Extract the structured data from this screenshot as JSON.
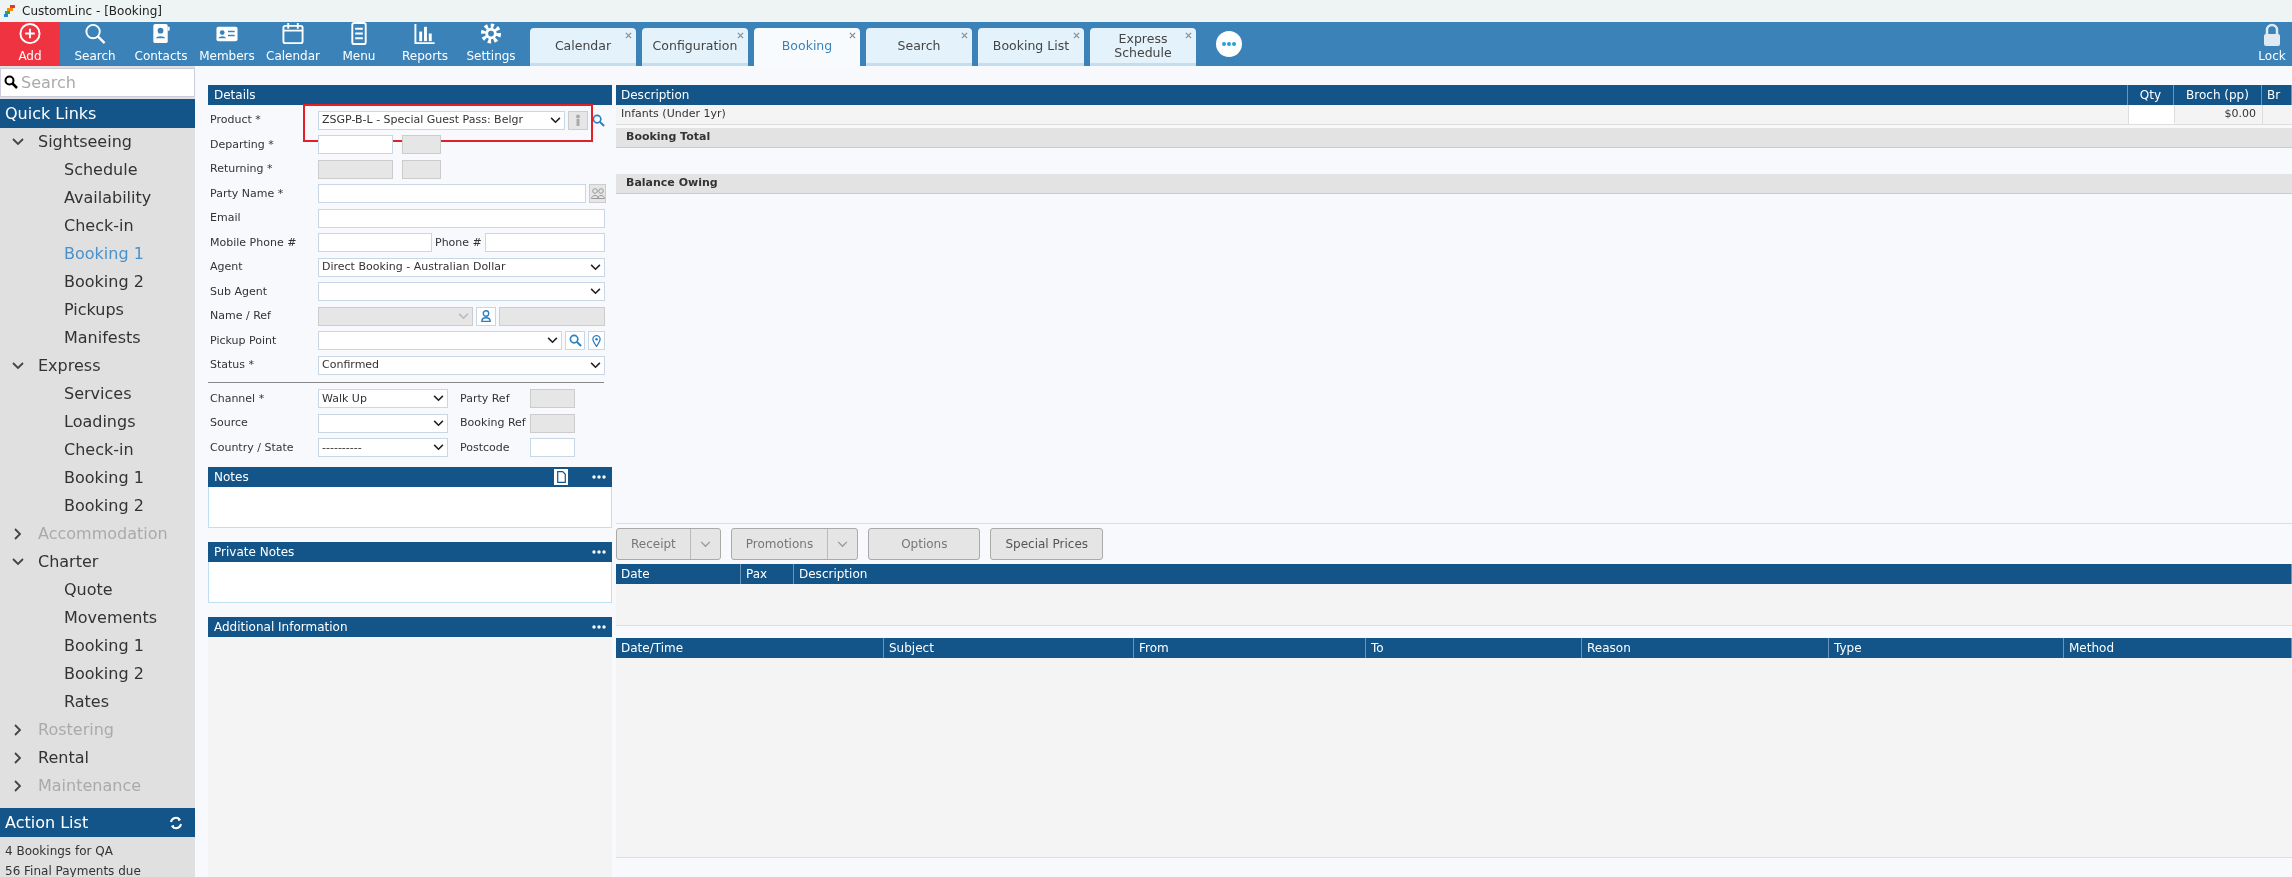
{
  "window": {
    "title": "CustomLinc - [Booking]"
  },
  "toolbar": [
    {
      "label": "Add",
      "kind": "add"
    },
    {
      "label": "Search",
      "kind": "search"
    },
    {
      "label": "Contacts",
      "kind": "contacts"
    },
    {
      "label": "Members",
      "kind": "members"
    },
    {
      "label": "Calendar",
      "kind": "calendar"
    },
    {
      "label": "Menu",
      "kind": "menu"
    },
    {
      "label": "Reports",
      "kind": "reports"
    },
    {
      "label": "Settings",
      "kind": "settings"
    }
  ],
  "tabs": [
    {
      "label": "Calendar",
      "selected": false
    },
    {
      "label": "Configuration",
      "selected": false
    },
    {
      "label": "Booking",
      "selected": true
    },
    {
      "label": "Search",
      "selected": false
    },
    {
      "label": "Booking List",
      "selected": false
    },
    {
      "label": "Express Schedule",
      "selected": false
    }
  ],
  "lock": {
    "label": "Lock"
  },
  "sidebar": {
    "search": {
      "placeholder": "Search"
    },
    "title": "Quick Links",
    "items": [
      {
        "label": "Sightseeing",
        "expanded": true,
        "disabled": false,
        "children": [
          {
            "label": "Schedule",
            "selected": false
          },
          {
            "label": "Availability",
            "selected": false
          },
          {
            "label": "Check-in",
            "selected": false
          },
          {
            "label": "Booking 1",
            "selected": true
          },
          {
            "label": "Booking 2",
            "selected": false
          },
          {
            "label": "Pickups",
            "selected": false
          },
          {
            "label": "Manifests",
            "selected": false
          }
        ]
      },
      {
        "label": "Express",
        "expanded": true,
        "disabled": false,
        "children": [
          {
            "label": "Services",
            "selected": false
          },
          {
            "label": "Loadings",
            "selected": false
          },
          {
            "label": "Check-in",
            "selected": false
          },
          {
            "label": "Booking 1",
            "selected": false
          },
          {
            "label": "Booking 2",
            "selected": false
          }
        ]
      },
      {
        "label": "Accommodation",
        "expanded": false,
        "disabled": true
      },
      {
        "label": "Charter",
        "expanded": true,
        "disabled": false,
        "children": [
          {
            "label": "Quote",
            "selected": false
          },
          {
            "label": "Movements",
            "selected": false
          },
          {
            "label": "Booking 1",
            "selected": false
          },
          {
            "label": "Booking 2",
            "selected": false
          },
          {
            "label": "Rates",
            "selected": false
          }
        ]
      },
      {
        "label": "Rostering",
        "expanded": false,
        "disabled": true
      },
      {
        "label": "Rental",
        "expanded": false,
        "disabled": false
      },
      {
        "label": "Maintenance",
        "expanded": false,
        "disabled": true
      }
    ],
    "action_list": {
      "title": "Action List",
      "items": [
        "4 Bookings for QA",
        "56 Final Payments due"
      ]
    }
  },
  "details": {
    "title": "Details",
    "rows": [
      {
        "kind": "product",
        "label": "Product *",
        "value": "ZSGP-B-L - Special Guest Pass: Belgr",
        "highlighted": true
      },
      {
        "kind": "date",
        "label": "Departing *",
        "disabled": false
      },
      {
        "kind": "date",
        "label": "Returning *",
        "disabled": true
      },
      {
        "kind": "party",
        "label": "Party Name *"
      },
      {
        "kind": "text",
        "label": "Email"
      },
      {
        "kind": "phone",
        "label": "Mobile Phone #",
        "label2": "Phone #"
      },
      {
        "kind": "select",
        "label": "Agent",
        "value": "Direct Booking - Australian Dollar"
      },
      {
        "kind": "select",
        "label": "Sub Agent"
      },
      {
        "kind": "nameref",
        "label": "Name / Ref"
      },
      {
        "kind": "pickup",
        "label": "Pickup Point"
      },
      {
        "kind": "select",
        "label": "Status *",
        "value": "Confirmed"
      }
    ],
    "rows2": [
      {
        "label": "Channel *",
        "value": "Walk Up",
        "label2": "Party Ref",
        "disabled2": true
      },
      {
        "label": "Source",
        "label2": "Booking Ref",
        "disabled2": true
      },
      {
        "label": "Country / State",
        "value": "----------",
        "label2": "Postcode",
        "disabled2": false
      }
    ]
  },
  "panels": [
    {
      "title": "Notes",
      "document_button": true,
      "kind": "small"
    },
    {
      "title": "Private Notes",
      "document_button": false,
      "kind": "small"
    },
    {
      "title": "Additional Information",
      "document_button": false,
      "kind": "fill"
    }
  ],
  "line_items": {
    "columns": [
      "Description",
      "Qty",
      "Broch (pp)",
      "Br"
    ],
    "rows": [
      {
        "description": "Infants (Under 1yr)",
        "broch": "$0.00"
      }
    ],
    "totals": [
      "Booking Total",
      "Balance Owing"
    ]
  },
  "buttons": [
    {
      "label": "Receipt",
      "dropdown": true,
      "disabled": true
    },
    {
      "label": "Promotions",
      "dropdown": true,
      "disabled": true
    },
    {
      "label": "Options",
      "dropdown": false,
      "disabled": true
    },
    {
      "label": "Special Prices",
      "dropdown": false,
      "disabled": false
    }
  ],
  "itinerary": {
    "columns": [
      "Date",
      "Pax",
      "Description"
    ]
  },
  "log": {
    "columns": [
      "Date/Time",
      "Subject",
      "From",
      "To",
      "Reason",
      "Type",
      "Method"
    ]
  }
}
